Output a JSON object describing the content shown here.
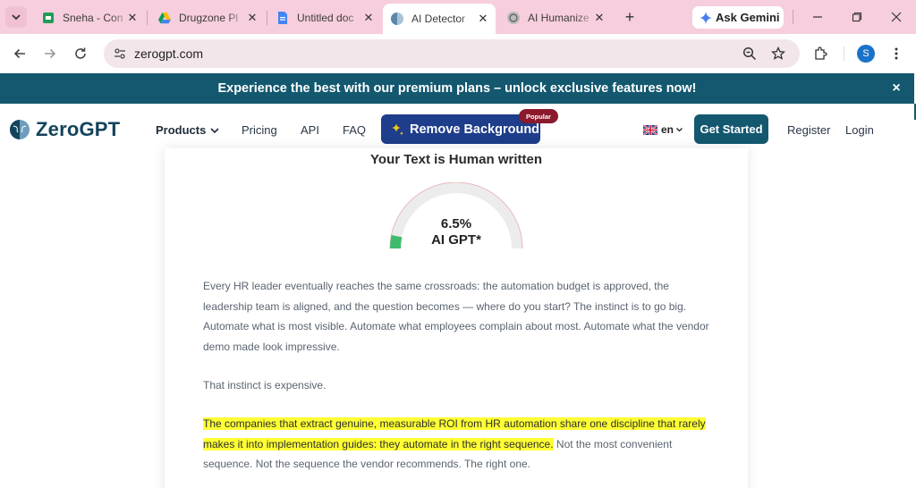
{
  "browser": {
    "tabs": [
      {
        "label": "Sneha - Con",
        "icon": "google-sheets-icon"
      },
      {
        "label": "Drugzone Pl",
        "icon": "google-drive-icon"
      },
      {
        "label": "Untitled doc",
        "icon": "google-docs-icon"
      },
      {
        "label": "AI Detector",
        "icon": "zerogpt-icon",
        "active": true
      },
      {
        "label": "AI Humanize",
        "icon": "humanizer-icon"
      }
    ],
    "gemini_label": "Ask Gemini",
    "url": "zerogpt.com",
    "profile_initial": "S"
  },
  "banner": {
    "text": "Experience the best with our premium plans – unlock exclusive features now!",
    "close": "×"
  },
  "site": {
    "logo_text": "ZeroGPT",
    "nav": {
      "products": "Products",
      "pricing": "Pricing",
      "api": "API",
      "faq": "FAQ"
    },
    "remove_bg_label": "Remove Background",
    "popular_badge": "Popular",
    "lang": "en",
    "get_started": "Get Started",
    "register": "Register",
    "login": "Login"
  },
  "result": {
    "title": "Your Text is Human written",
    "percent_text": "6.5%",
    "percent_value": 6.5,
    "gauge_label": "AI GPT*",
    "gauge_color": "#3dbb6a"
  },
  "content": {
    "p1": "Every HR leader eventually reaches the same crossroads: the automation budget is approved, the leadership team is aligned, and the question becomes — where do you start? The instinct is to go big. Automate what is most visible. Automate what employees complain about most. Automate what the vendor demo made look impressive.",
    "p2": "That instinct is expensive.",
    "p3_highlight": "The companies that extract genuine, measurable ROI from HR automation share one discipline that rarely makes it into implementation guides: they automate in the right sequence.",
    "p3_rest": " Not the most convenient sequence. Not the sequence the vendor recommends. The right one."
  },
  "colors": {
    "tabstrip": "#f7cedd",
    "banner": "#13586f",
    "brand_dark": "#13445c",
    "remove_bg": "#1e3d8a",
    "popular": "#8a1a2c",
    "highlight": "#ffff33"
  }
}
